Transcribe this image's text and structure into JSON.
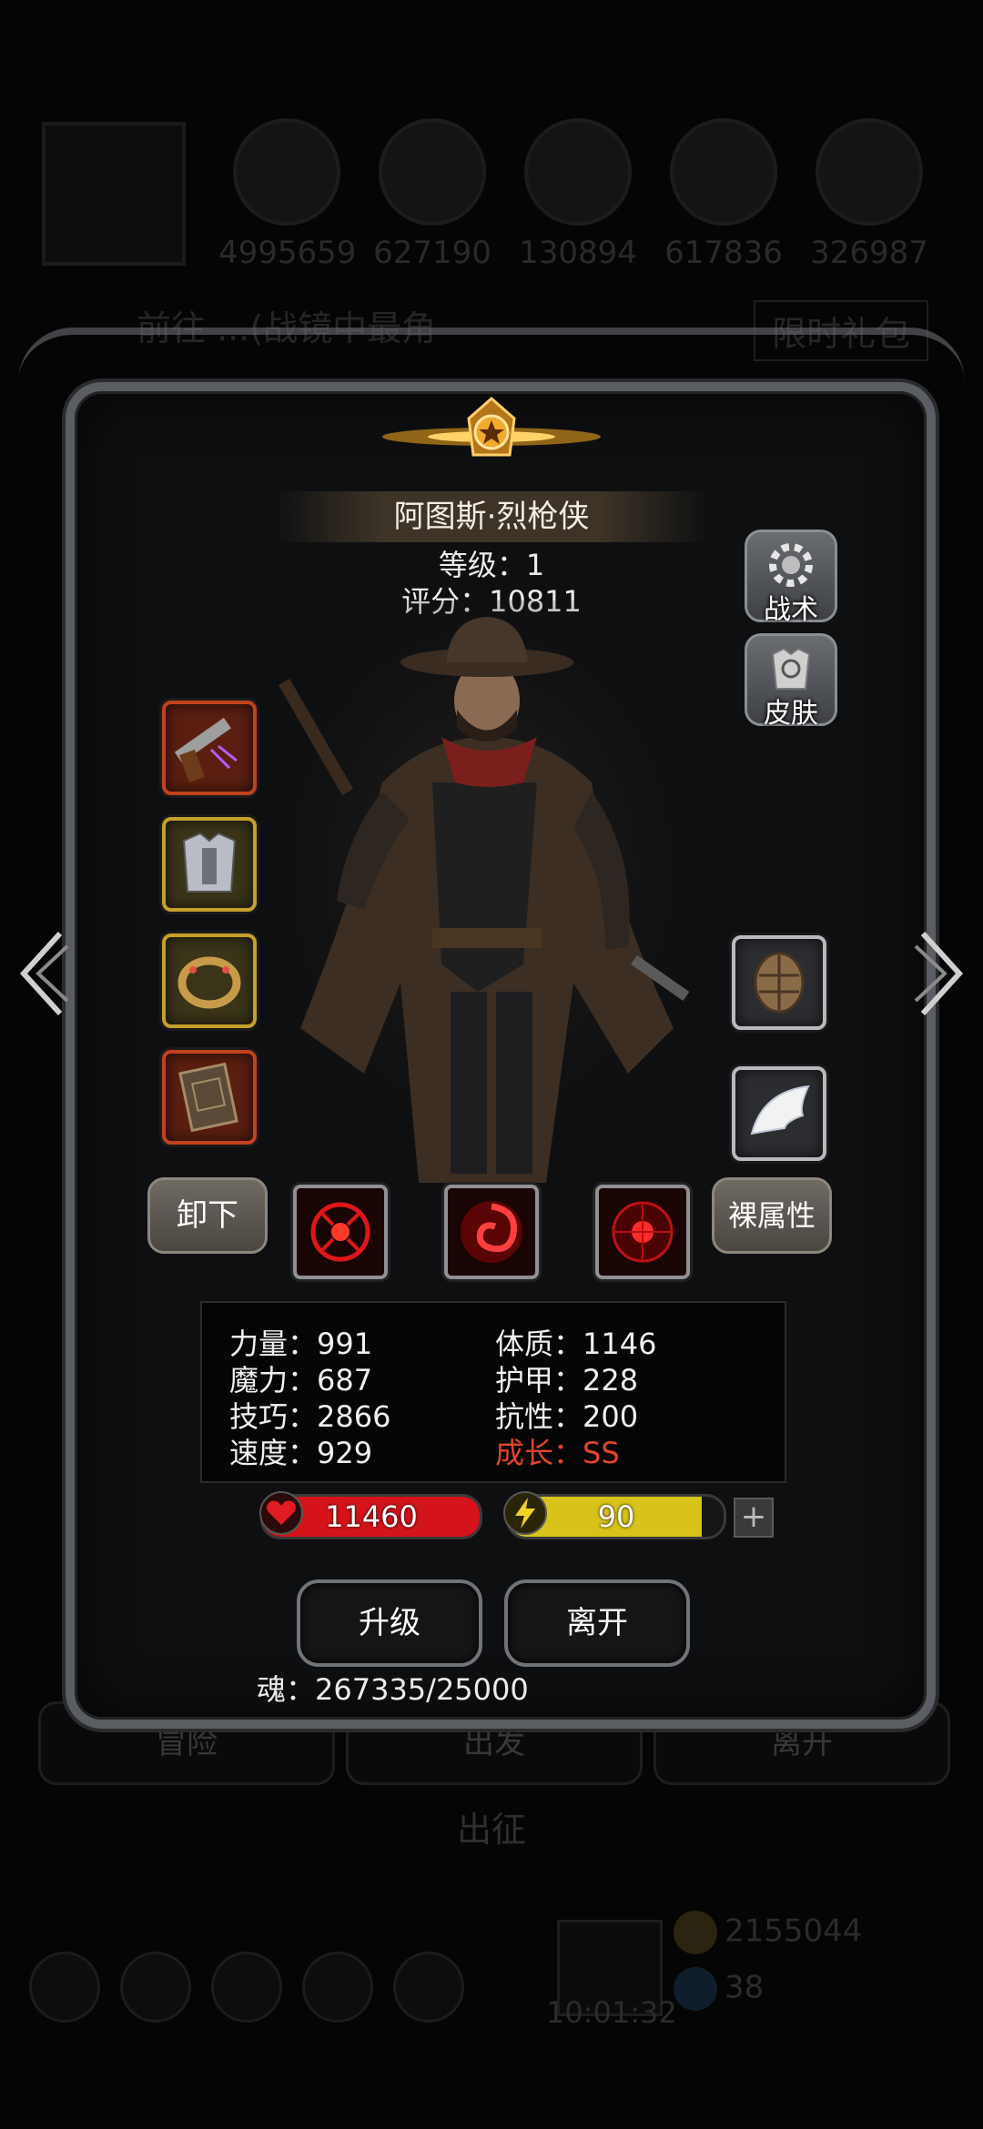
{
  "background": {
    "resources": [
      {
        "icon": "copper-ore-icon",
        "value": "4995659"
      },
      {
        "icon": "gold-ore-icon",
        "value": "627190"
      },
      {
        "icon": "iron-ore-icon",
        "value": "130894"
      },
      {
        "icon": "crystal-icon",
        "value": "617836"
      },
      {
        "icon": "stone-icon",
        "value": "326987"
      }
    ],
    "banner_text": "前往 ...(战镜中最角",
    "banner_right": "限时礼包",
    "nav": {
      "adventure": "冒险",
      "depart": "出发",
      "leave": "离开"
    },
    "expedition_title": "出征",
    "timer": "10:01:32",
    "coins": "2155044",
    "gems": "38"
  },
  "hero": {
    "name": "阿图斯·烈枪侠",
    "level": "等级：1",
    "score": "评分：10811"
  },
  "side_buttons": {
    "tactics": "战术",
    "skin": "皮肤"
  },
  "equipment_left": [
    {
      "slot": "pistol-icon",
      "rarity": "red"
    },
    {
      "slot": "armor-icon",
      "rarity": "gold"
    },
    {
      "slot": "ring-icon",
      "rarity": "gold"
    },
    {
      "slot": "book-icon",
      "rarity": "red"
    }
  ],
  "equipment_right": [
    {
      "slot": "shell-icon",
      "rarity": "silver"
    },
    {
      "slot": "wing-icon",
      "rarity": "silver"
    }
  ],
  "actions": {
    "unequip": "卸下",
    "naked_stats": "裸属性"
  },
  "skills": [
    "target-skill-icon",
    "vortex-skill-icon",
    "crosshair-skill-icon"
  ],
  "stats": {
    "strength": "力量：991",
    "magic": "魔力：687",
    "skill": "技巧：2866",
    "speed": "速度：929",
    "constitution": "体质：1146",
    "armor": "护甲：228",
    "resistance": "抗性：200",
    "growth": "成长：SS"
  },
  "hp": {
    "value": "11460",
    "fill": 1.0,
    "color": "#d4131b"
  },
  "energy": {
    "value": "90",
    "fill": 0.9,
    "color": "#d8c31a"
  },
  "buttons": {
    "upgrade": "升级",
    "leave": "离开"
  },
  "soul": "魂：267335/25000",
  "colors": {
    "growth": "#e2452a",
    "hp": "#d4131b",
    "energy": "#d8c31a"
  }
}
